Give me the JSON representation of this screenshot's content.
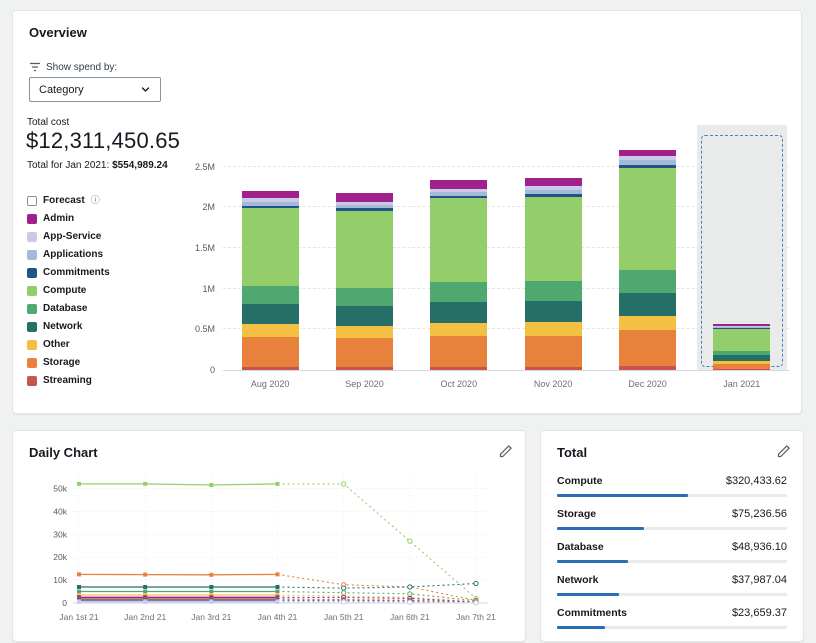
{
  "overview": {
    "title": "Overview",
    "show_spend_by_label": "Show spend by:",
    "category_select_value": "Category",
    "total_cost_label": "Total cost",
    "total_cost_value": "$12,311,450.65",
    "subtotal_prefix": "Total for Jan 2021:",
    "subtotal_value": "$554,989.24",
    "forecast_legend_label": "Forecast"
  },
  "legend": [
    {
      "label": "Admin",
      "color": "#a0218c"
    },
    {
      "label": "App-Service",
      "color": "#c9cbe8"
    },
    {
      "label": "Applications",
      "color": "#a3bad8"
    },
    {
      "label": "Commitments",
      "color": "#20558a"
    },
    {
      "label": "Compute",
      "color": "#93ce6b"
    },
    {
      "label": "Database",
      "color": "#4ea870"
    },
    {
      "label": "Network",
      "color": "#266f66"
    },
    {
      "label": "Other",
      "color": "#f3c043"
    },
    {
      "label": "Storage",
      "color": "#e8813c"
    },
    {
      "label": "Streaming",
      "color": "#c9534e"
    }
  ],
  "chart_data": [
    {
      "type": "bar",
      "stacked": true,
      "title": "Monthly spend by category",
      "categories": [
        "Aug 2020",
        "Sep 2020",
        "Oct 2020",
        "Nov 2020",
        "Dec 2020",
        "Jan 2021"
      ],
      "unit": "USD (millions)",
      "ylim": [
        0,
        2.9
      ],
      "yticks": [
        {
          "label": "0",
          "value": 0
        },
        {
          "label": "0.5M",
          "value": 0.5
        },
        {
          "label": "1M",
          "value": 1
        },
        {
          "label": "1.5M",
          "value": 1.5
        },
        {
          "label": "2M",
          "value": 2
        },
        {
          "label": "2.5M",
          "value": 2.5
        }
      ],
      "forecast_category": "Jan 2021",
      "series": [
        {
          "name": "Streaming",
          "color": "#c9534e",
          "values": [
            0.04,
            0.04,
            0.04,
            0.04,
            0.05,
            0.01
          ]
        },
        {
          "name": "Storage",
          "color": "#e8813c",
          "values": [
            0.36,
            0.35,
            0.38,
            0.38,
            0.44,
            0.06
          ]
        },
        {
          "name": "Other",
          "color": "#f3c043",
          "values": [
            0.16,
            0.15,
            0.16,
            0.17,
            0.18,
            0.04
          ]
        },
        {
          "name": "Network",
          "color": "#266f66",
          "values": [
            0.25,
            0.25,
            0.26,
            0.26,
            0.28,
            0.07
          ]
        },
        {
          "name": "Database",
          "color": "#4ea870",
          "values": [
            0.22,
            0.22,
            0.24,
            0.24,
            0.28,
            0.05
          ]
        },
        {
          "name": "Compute",
          "color": "#93ce6b",
          "values": [
            0.96,
            0.95,
            1.03,
            1.04,
            1.25,
            0.27
          ]
        },
        {
          "name": "Commitments",
          "color": "#20558a",
          "values": [
            0.03,
            0.03,
            0.03,
            0.03,
            0.04,
            0.01
          ]
        },
        {
          "name": "Applications",
          "color": "#a3bad8",
          "values": [
            0.05,
            0.04,
            0.05,
            0.05,
            0.06,
            0.02
          ]
        },
        {
          "name": "App-Service",
          "color": "#c9cbe8",
          "values": [
            0.04,
            0.04,
            0.04,
            0.05,
            0.05,
            0.01
          ]
        },
        {
          "name": "Admin",
          "color": "#a0218c",
          "values": [
            0.09,
            0.1,
            0.1,
            0.1,
            0.07,
            0.02
          ]
        }
      ]
    },
    {
      "type": "line",
      "title": "Daily Chart",
      "x": [
        "Jan 1st 21",
        "Jan 2nd 21",
        "Jan 3rd 21",
        "Jan 4th 21",
        "Jan 5th 21",
        "Jan 6th 21",
        "Jan 7th 21"
      ],
      "unit": "USD (thousands)",
      "ylim": [
        0,
        55
      ],
      "yticks": [
        {
          "label": "0",
          "value": 0
        },
        {
          "label": "10k",
          "value": 10
        },
        {
          "label": "20k",
          "value": 20
        },
        {
          "label": "30k",
          "value": 30
        },
        {
          "label": "40k",
          "value": 40
        },
        {
          "label": "50k",
          "value": 50
        }
      ],
      "actual_through_index": 3,
      "series": [
        {
          "name": "Compute",
          "color": "#93ce6b",
          "values": [
            52,
            52,
            51.5,
            52,
            52,
            27,
            2
          ]
        },
        {
          "name": "Storage",
          "color": "#e8813c",
          "values": [
            12.5,
            12.4,
            12.3,
            12.5,
            8,
            7,
            1.2
          ]
        },
        {
          "name": "Network",
          "color": "#266f66",
          "values": [
            7,
            7,
            7,
            7,
            6.5,
            7,
            8.5
          ]
        },
        {
          "name": "Database",
          "color": "#4ea870",
          "values": [
            5,
            5,
            5,
            5,
            4.5,
            4,
            1
          ]
        },
        {
          "name": "Other",
          "color": "#f3c043",
          "values": [
            3.5,
            3.5,
            3.5,
            3.5,
            3,
            2.5,
            0.6
          ]
        },
        {
          "name": "Admin",
          "color": "#a0218c",
          "values": [
            2.5,
            2.5,
            2.5,
            2.5,
            2.4,
            2,
            0.4
          ]
        },
        {
          "name": "Streaming",
          "color": "#c9534e",
          "values": [
            1.8,
            1.8,
            1.8,
            1.8,
            1.5,
            1.2,
            0.3
          ]
        },
        {
          "name": "Commitments",
          "color": "#20558a",
          "values": [
            1.2,
            1.2,
            1.2,
            1.2,
            1,
            0.8,
            0.2
          ]
        },
        {
          "name": "Applications",
          "color": "#a3bad8",
          "values": [
            0.8,
            0.8,
            0.8,
            0.8,
            0.7,
            0.5,
            0.15
          ]
        },
        {
          "name": "App-Service",
          "color": "#c9cbe8",
          "values": [
            0.5,
            0.5,
            0.5,
            0.5,
            0.4,
            0.3,
            0.1
          ]
        }
      ]
    }
  ],
  "daily_chart": {
    "title": "Daily Chart"
  },
  "total_panel": {
    "title": "Total",
    "accent_color": "#2a6db0",
    "rows": [
      {
        "label": "Compute",
        "value": "$320,433.62",
        "bar_fraction": 0.57
      },
      {
        "label": "Storage",
        "value": "$75,236.56",
        "bar_fraction": 0.38
      },
      {
        "label": "Database",
        "value": "$48,936.10",
        "bar_fraction": 0.31
      },
      {
        "label": "Network",
        "value": "$37,987.04",
        "bar_fraction": 0.27
      },
      {
        "label": "Commitments",
        "value": "$23,659.37",
        "bar_fraction": 0.21
      }
    ]
  },
  "colors": {
    "forecast_border": "#4f7cc9",
    "forecast_band": "#e9eaea",
    "accent": "#2a6db0"
  }
}
